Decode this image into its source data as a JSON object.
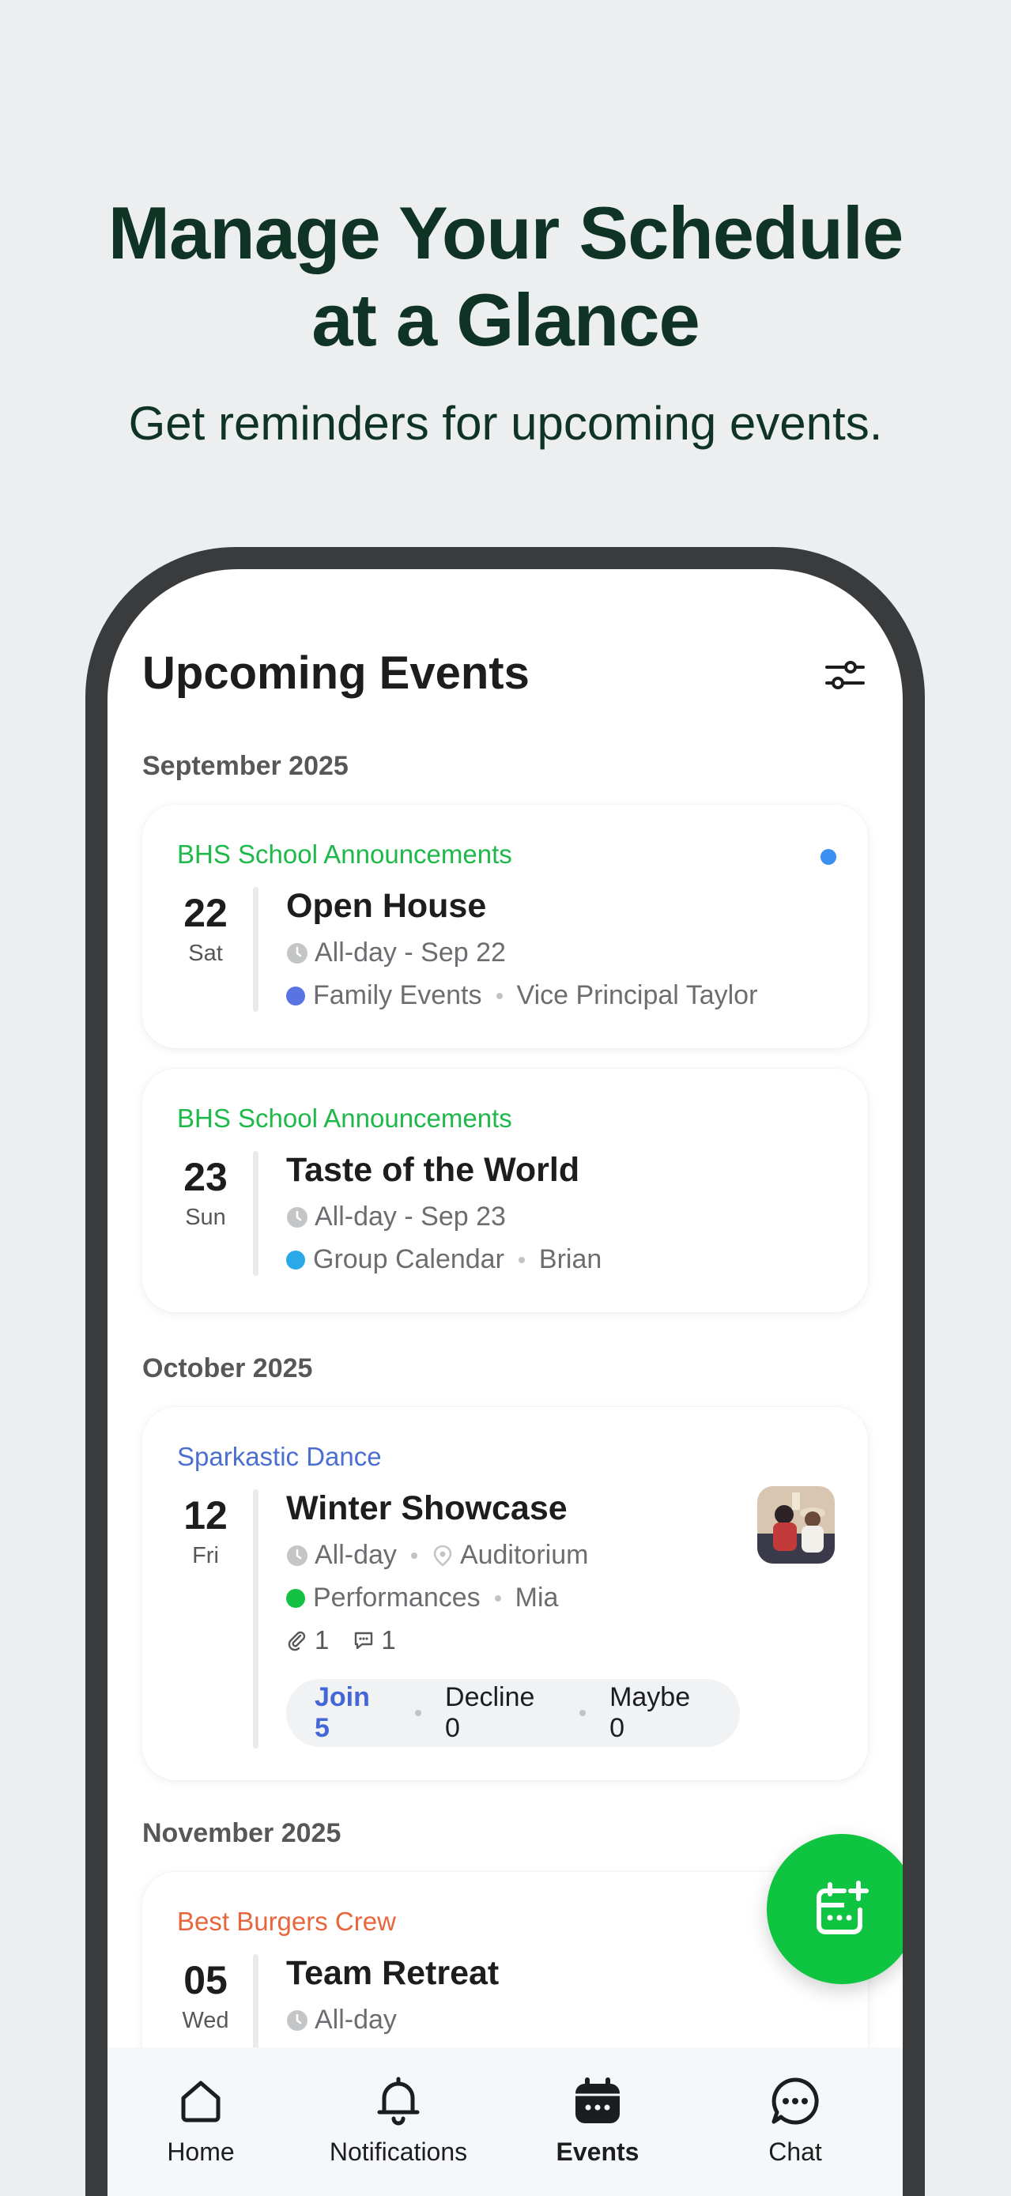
{
  "hero": {
    "title_line1": "Manage Your Schedule",
    "title_line2": "at a Glance",
    "subtitle": "Get reminders for upcoming events."
  },
  "screen": {
    "title": "Upcoming Events",
    "filter_icon": "sliders-icon"
  },
  "months": [
    "September 2025",
    "October 2025",
    "November 2025"
  ],
  "events": [
    {
      "group": "BHS School Announcements",
      "group_color": "#1fb84a",
      "unread": true,
      "day": "22",
      "dow": "Sat",
      "title": "Open House",
      "time": "All-day - Sep 22",
      "calendar": "Family Events",
      "calendar_color": "#5874e3",
      "organizer": "Vice Principal Taylor"
    },
    {
      "group": "BHS School Announcements",
      "group_color": "#1fb84a",
      "unread": false,
      "day": "23",
      "dow": "Sun",
      "title": "Taste of the World",
      "time": "All-day - Sep 23",
      "calendar": "Group Calendar",
      "calendar_color": "#2aa8e8",
      "organizer": "Brian"
    },
    {
      "group": "Sparkastic Dance",
      "group_color": "#4a6fd0",
      "unread": false,
      "day": "12",
      "dow": "Fri",
      "title": "Winter Showcase",
      "time": "All-day",
      "location": "Auditorium",
      "calendar": "Performances",
      "calendar_color": "#15c144",
      "organizer": "Mia",
      "attachments": "1",
      "comments": "1",
      "rsvp": {
        "join": "Join 5",
        "decline": "Decline 0",
        "maybe": "Maybe 0"
      }
    },
    {
      "group": "Best Burgers Crew",
      "group_color": "#e8663e",
      "unread": false,
      "day": "05",
      "dow": "Wed",
      "title": "Team Retreat",
      "time": "All-day"
    }
  ],
  "fab": {
    "icon": "add-event-icon"
  },
  "tabs": [
    {
      "label": "Home",
      "icon": "home-icon",
      "active": false
    },
    {
      "label": "Notifications",
      "icon": "bell-icon",
      "active": false
    },
    {
      "label": "Events",
      "icon": "calendar-icon",
      "active": true
    },
    {
      "label": "Chat",
      "icon": "chat-icon",
      "active": false
    }
  ]
}
